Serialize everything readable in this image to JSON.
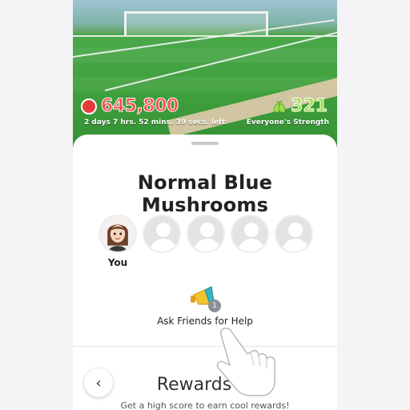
{
  "event": {
    "score": "645,800",
    "time_left": "2 days 7 hrs. 52 mins. 39 secs. left",
    "strength": "321",
    "strength_label": "Everyone's Strength"
  },
  "title": "Normal Blue Mushrooms",
  "members": [
    {
      "label": "You"
    },
    {
      "label": ""
    },
    {
      "label": ""
    },
    {
      "label": ""
    },
    {
      "label": ""
    }
  ],
  "help": {
    "label": "Ask Friends for Help",
    "badge": "1"
  },
  "rewards": {
    "title": "Rewards",
    "subtitle": "Get a high score to earn cool rewards!",
    "info": "i",
    "back": "‹"
  },
  "colors": {
    "score": "#ff4a4a",
    "strength": "#9be04a",
    "field": "#3fa03c"
  }
}
